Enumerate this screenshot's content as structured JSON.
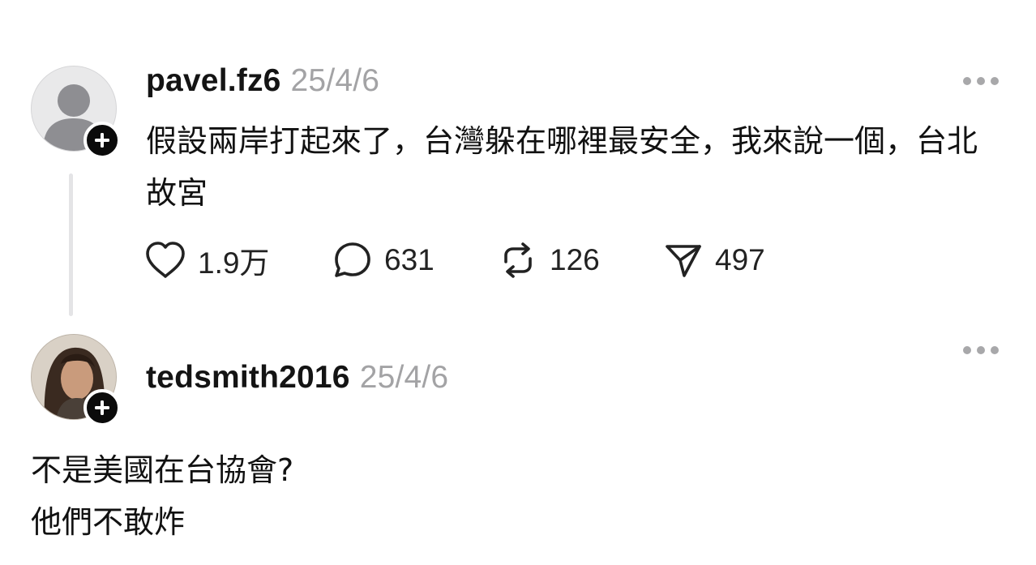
{
  "post": {
    "username": "pavel.fz6",
    "timestamp": "25/4/6",
    "text": "假設兩岸打起來了，台灣躲在哪裡最安全，我來說一個，台北故宮",
    "more_icon": "more-horizontal-icon",
    "avatar_icon": "default-user-avatar",
    "actions": {
      "likes": "1.9万",
      "comments": "631",
      "reposts": "126",
      "shares": "497"
    }
  },
  "reply": {
    "username": "tedsmith2016",
    "timestamp": "25/4/6",
    "more_icon": "more-horizontal-icon",
    "avatar_icon": "photo-avatar",
    "text_line1": "不是美國在台協會?",
    "text_line2": "他們不敢炸"
  },
  "colors": {
    "text": "#111111",
    "muted": "#a3a3a5",
    "badge": "#0b0b0b",
    "thread_line": "#e4e4e6"
  }
}
